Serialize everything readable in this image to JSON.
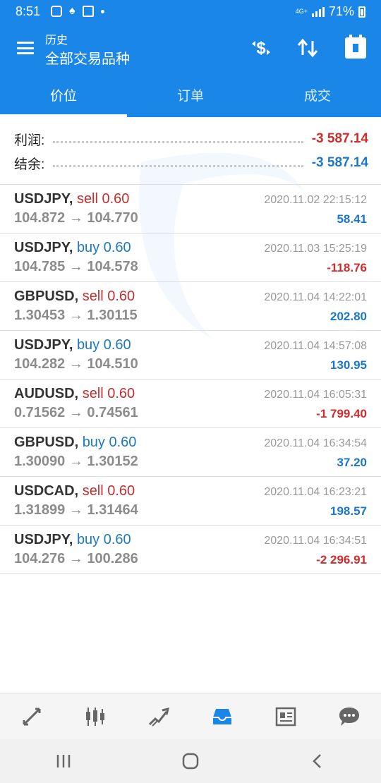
{
  "status_bar": {
    "time": "8:51",
    "network": "4G+",
    "battery": "71%",
    "icons": [
      "instagram-icon",
      "app-notification-icon",
      "gallery-icon",
      "dot-icon"
    ]
  },
  "app_bar": {
    "subtitle": "历史",
    "title": "全部交易品种",
    "icons": [
      "menu-icon",
      "currency-exchange-icon",
      "sort-icon",
      "calendar-icon"
    ]
  },
  "tabs": [
    {
      "label": "价位",
      "active": true
    },
    {
      "label": "订单",
      "active": false
    },
    {
      "label": "成交",
      "active": false
    }
  ],
  "summary": {
    "profit_label": "利润:",
    "profit_value": "-3 587.14",
    "balance_label": "结余:",
    "balance_value": "-3 587.14"
  },
  "trades": [
    {
      "symbol": "USDJPY,",
      "side": "sell 0.60",
      "type": "sell",
      "open": "104.872",
      "close": "104.770",
      "time": "2020.11.02 22:15:12",
      "profit": "58.41",
      "profit_sign": "pos"
    },
    {
      "symbol": "USDJPY,",
      "side": "buy 0.60",
      "type": "buy",
      "open": "104.785",
      "close": "104.578",
      "time": "2020.11.03 15:25:19",
      "profit": "-118.76",
      "profit_sign": "neg"
    },
    {
      "symbol": "GBPUSD,",
      "side": "sell 0.60",
      "type": "sell",
      "open": "1.30453",
      "close": "1.30115",
      "time": "2020.11.04 14:22:01",
      "profit": "202.80",
      "profit_sign": "pos"
    },
    {
      "symbol": "USDJPY,",
      "side": "buy 0.60",
      "type": "buy",
      "open": "104.282",
      "close": "104.510",
      "time": "2020.11.04 14:57:08",
      "profit": "130.95",
      "profit_sign": "pos"
    },
    {
      "symbol": "AUDUSD,",
      "side": "sell 0.60",
      "type": "sell",
      "open": "0.71562",
      "close": "0.74561",
      "time": "2020.11.04 16:05:31",
      "profit": "-1 799.40",
      "profit_sign": "neg"
    },
    {
      "symbol": "GBPUSD,",
      "side": "buy 0.60",
      "type": "buy",
      "open": "1.30090",
      "close": "1.30152",
      "time": "2020.11.04 16:34:54",
      "profit": "37.20",
      "profit_sign": "pos"
    },
    {
      "symbol": "USDCAD,",
      "side": "sell 0.60",
      "type": "sell",
      "open": "1.31899",
      "close": "1.31464",
      "time": "2020.11.04 16:23:21",
      "profit": "198.57",
      "profit_sign": "pos"
    },
    {
      "symbol": "USDJPY,",
      "side": "buy 0.60",
      "type": "buy",
      "open": "104.276",
      "close": "100.286",
      "time": "2020.11.04 16:34:51",
      "profit": "-2 296.91",
      "profit_sign": "neg"
    }
  ],
  "arrow_glyph": "→",
  "bottom_nav": [
    {
      "name": "quotes-nav-icon",
      "active": false
    },
    {
      "name": "chart-candles-nav-icon",
      "active": false
    },
    {
      "name": "trade-nav-icon",
      "active": false
    },
    {
      "name": "history-inbox-nav-icon",
      "active": true
    },
    {
      "name": "news-nav-icon",
      "active": false
    },
    {
      "name": "chat-nav-icon",
      "active": false
    }
  ],
  "colors": {
    "primary": "#1a86e8",
    "profit_positive": "#1b78c8",
    "profit_negative": "#d12b2b",
    "sell": "#c62d2d",
    "buy": "#1b78c8"
  }
}
